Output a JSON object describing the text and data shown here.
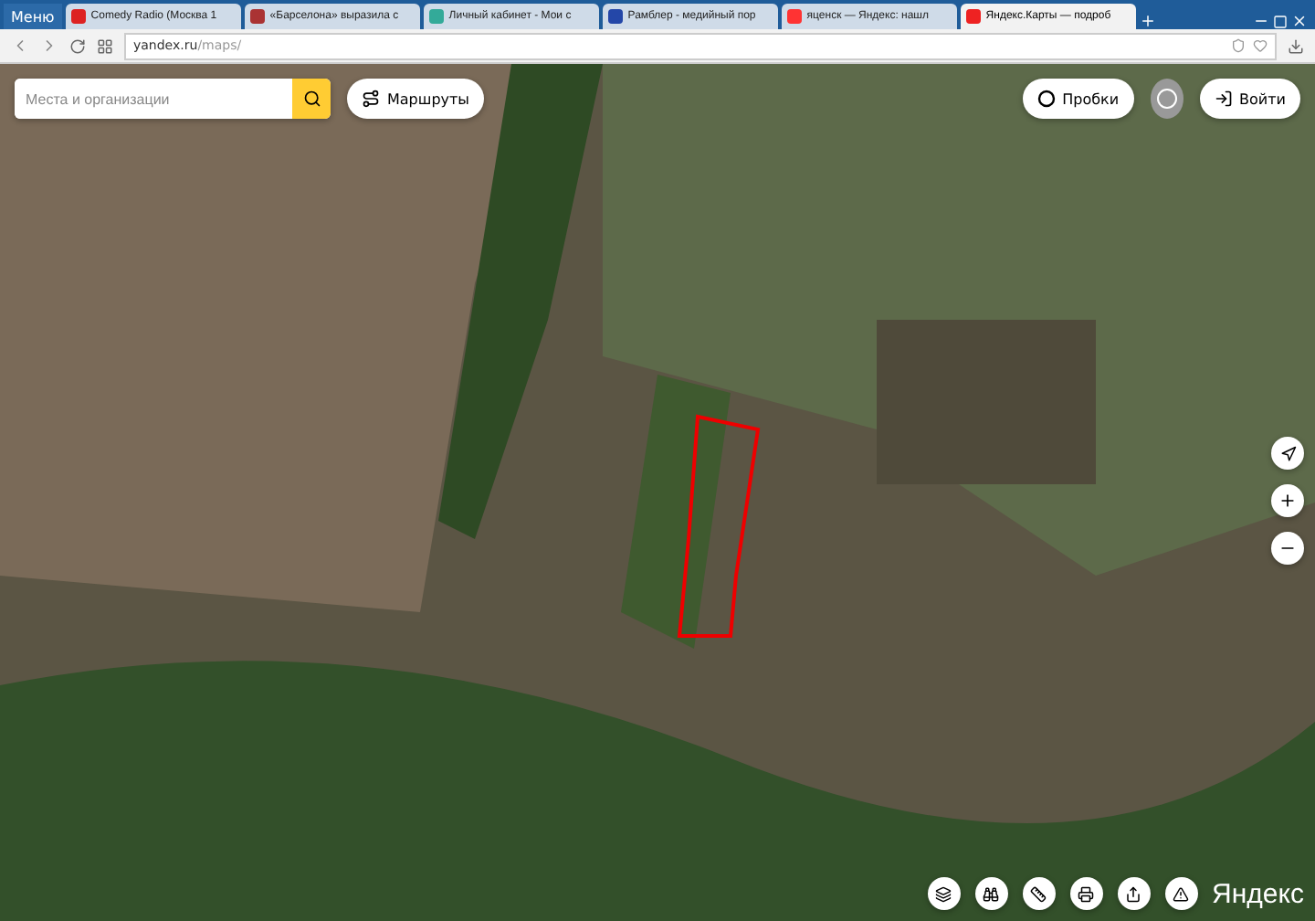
{
  "browser": {
    "menu": "Меню",
    "tabs": [
      {
        "title": "Comedy Radio (Москва 1",
        "selected": false,
        "kind": "radio"
      },
      {
        "title": "«Барселона» выразила с",
        "selected": false,
        "kind": "news"
      },
      {
        "title": "Личный кабинет - Мои с",
        "selected": false,
        "kind": "grid"
      },
      {
        "title": "Рамблер - медийный пор",
        "selected": false,
        "kind": "rambler"
      },
      {
        "title": "яценск — Яндекс: нашл",
        "selected": false,
        "kind": "yandex"
      },
      {
        "title": "Яндекс.Карты — подроб",
        "selected": true,
        "kind": "maps"
      }
    ],
    "url_host": "yandex.ru",
    "url_path": "/maps/"
  },
  "map": {
    "search": {
      "placeholder": "Места и организации"
    },
    "routes_button": "Маршруты",
    "traffic_button": "Пробки",
    "login_button": "Войти",
    "logo": "Яндекс"
  }
}
